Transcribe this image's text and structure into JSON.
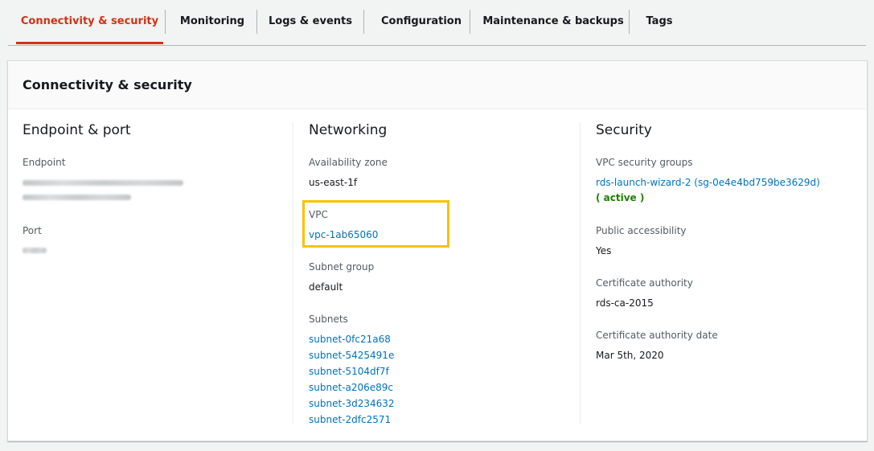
{
  "tabs": [
    {
      "label": "Connectivity & security",
      "active": true
    },
    {
      "label": "Monitoring"
    },
    {
      "label": "Logs & events"
    },
    {
      "label": "Configuration"
    },
    {
      "label": "Maintenance & backups"
    },
    {
      "label": "Tags"
    }
  ],
  "panel": {
    "title": "Connectivity & security"
  },
  "endpoint_port": {
    "title": "Endpoint & port",
    "endpoint_label": "Endpoint",
    "port_label": "Port"
  },
  "networking": {
    "title": "Networking",
    "availability_zone_label": "Availability zone",
    "availability_zone": "us-east-1f",
    "vpc_label": "VPC",
    "vpc": "vpc-1ab65060",
    "subnet_group_label": "Subnet group",
    "subnet_group": "default",
    "subnets_label": "Subnets",
    "subnets": [
      "subnet-0fc21a68",
      "subnet-5425491e",
      "subnet-5104df7f",
      "subnet-a206e89c",
      "subnet-3d234632",
      "subnet-2dfc2571"
    ]
  },
  "security": {
    "title": "Security",
    "vpc_security_groups_label": "VPC security groups",
    "security_group": "rds-launch-wizard-2 (sg-0e4e4bd759be3629d)",
    "security_group_status": "( active )",
    "public_accessibility_label": "Public accessibility",
    "public_accessibility": "Yes",
    "certificate_authority_label": "Certificate authority",
    "certificate_authority": "rds-ca-2015",
    "certificate_authority_date_label": "Certificate authority date",
    "certificate_authority_date": "Mar 5th, 2020"
  },
  "colors": {
    "active_tab": "#d13212",
    "link": "#0073bb",
    "status_active": "#1d8102",
    "highlight": "#f7c300"
  }
}
